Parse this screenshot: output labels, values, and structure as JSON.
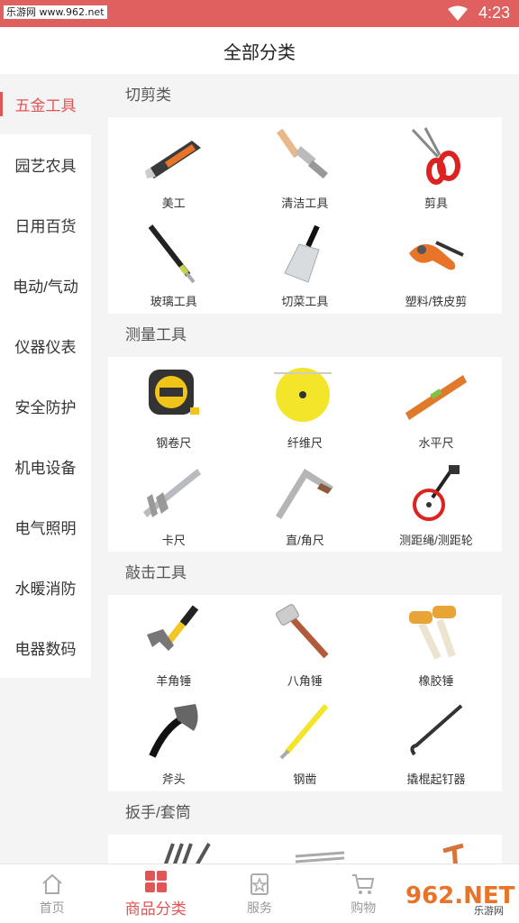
{
  "status": {
    "watermark": "乐游网 www.962.net",
    "time": "4:23"
  },
  "header": {
    "title": "全部分类"
  },
  "colors": {
    "accent": "#e05555",
    "status_bar": "#e06060"
  },
  "sidebar": {
    "items": [
      {
        "label": "五金工具",
        "active": true
      },
      {
        "label": "园艺农具"
      },
      {
        "label": "日用百货"
      },
      {
        "label": "电动/气动"
      },
      {
        "label": "仪器仪表"
      },
      {
        "label": "安全防护"
      },
      {
        "label": "机电设备"
      },
      {
        "label": "电气照明"
      },
      {
        "label": "水暖消防"
      },
      {
        "label": "电器数码"
      }
    ]
  },
  "sections": [
    {
      "title": "切剪类",
      "items": [
        {
          "label": "美工",
          "icon": "utility-knife-icon"
        },
        {
          "label": "清洁工具",
          "icon": "scraper-icon"
        },
        {
          "label": "剪具",
          "icon": "scissors-icon"
        },
        {
          "label": "玻璃工具",
          "icon": "glass-cutter-icon"
        },
        {
          "label": "切菜工具",
          "icon": "cleaver-icon"
        },
        {
          "label": "塑料/铁皮剪",
          "icon": "pipe-cutter-icon"
        }
      ]
    },
    {
      "title": "测量工具",
      "items": [
        {
          "label": "钢卷尺",
          "icon": "tape-measure-icon"
        },
        {
          "label": "纤维尺",
          "icon": "fiber-tape-icon"
        },
        {
          "label": "水平尺",
          "icon": "spirit-level-icon"
        },
        {
          "label": "卡尺",
          "icon": "caliper-icon"
        },
        {
          "label": "直/角尺",
          "icon": "square-ruler-icon"
        },
        {
          "label": "测距绳/测距轮",
          "icon": "measuring-wheel-icon"
        }
      ]
    },
    {
      "title": "敲击工具",
      "items": [
        {
          "label": "羊角锤",
          "icon": "claw-hammer-icon"
        },
        {
          "label": "八角锤",
          "icon": "sledge-hammer-icon"
        },
        {
          "label": "橡胶锤",
          "icon": "rubber-mallet-icon"
        },
        {
          "label": "斧头",
          "icon": "axe-icon"
        },
        {
          "label": "钢凿",
          "icon": "chisel-icon"
        },
        {
          "label": "撬棍起钉器",
          "icon": "crowbar-icon"
        }
      ]
    },
    {
      "title": "扳手/套筒",
      "items": []
    }
  ],
  "tabbar": {
    "items": [
      {
        "label": "首页",
        "icon": "home-icon"
      },
      {
        "label": "商品分类",
        "icon": "category-icon",
        "active": true
      },
      {
        "label": "服务",
        "icon": "service-icon"
      },
      {
        "label": "购物",
        "icon": "cart-icon"
      }
    ]
  },
  "branding": {
    "logo_text": "962.NET",
    "logo_sub": "乐游网"
  }
}
